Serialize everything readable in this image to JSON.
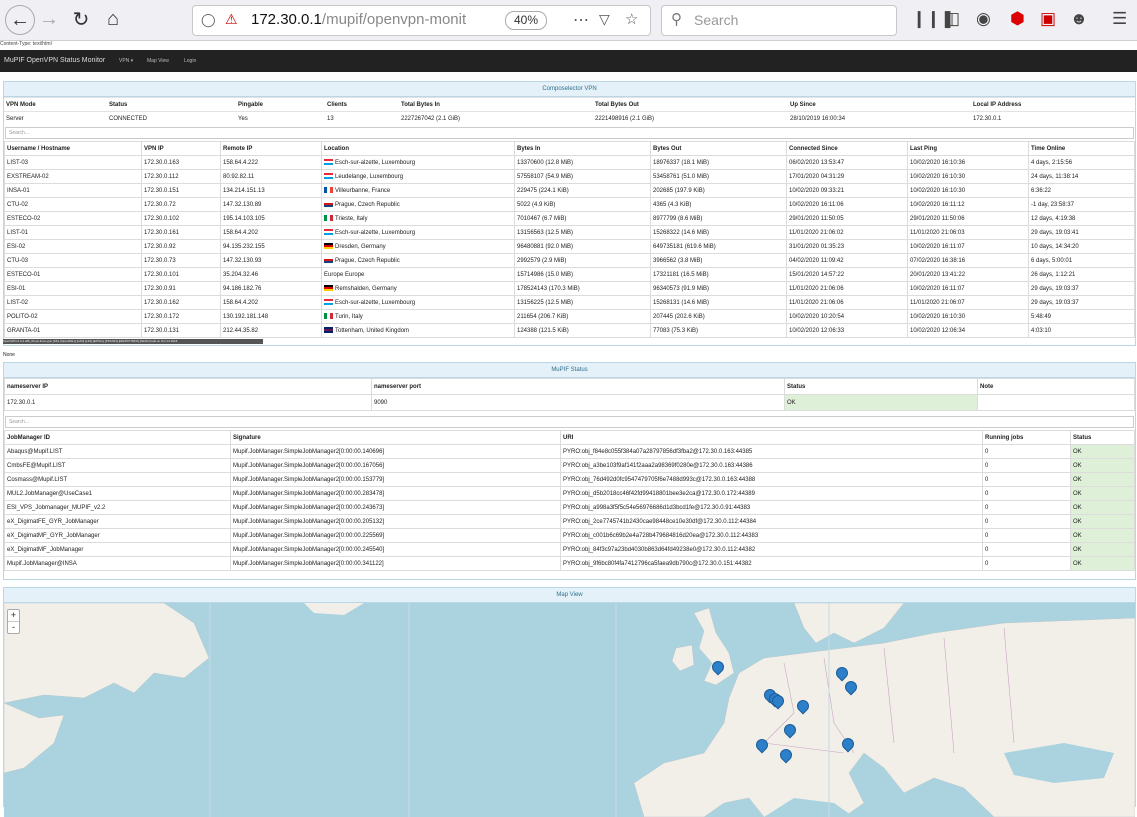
{
  "browser": {
    "url_host": "172.30.0.1",
    "url_path": "/mupif/openvpn-monit",
    "zoom": "40%",
    "search_placeholder": "Search",
    "content_type_line": "Content-Type: text/html"
  },
  "navbar": {
    "brand": "MuPIF OpenVPN Status Monitor",
    "links": [
      "VPN ▾",
      "Map View",
      "Login"
    ]
  },
  "vpn": {
    "title": "Composelector VPN",
    "summary_headers": [
      "VPN Mode",
      "Status",
      "Pingable",
      "Clients",
      "Total Bytes In",
      "Total Bytes Out",
      "Up Since",
      "Local IP Address"
    ],
    "summary_row": [
      "Server",
      "CONNECTED",
      "Yes",
      "13",
      "2227267042 (2.1 GiB)",
      "2221498916 (2.1 GiB)",
      "28/10/2019 16:00:34",
      "172.30.0.1"
    ],
    "search_placeholder": "Search...",
    "client_headers": [
      "Username / Hostname",
      "VPN IP",
      "Remote IP",
      "Location",
      "Bytes In",
      "Bytes Out",
      "Connected Since",
      "Last Ping",
      "Time Online"
    ],
    "clients": [
      {
        "name": "LIST-03",
        "vpn_ip": "172.30.0.163",
        "remote_ip": "158.64.4.222",
        "flag": "lu",
        "location": "Esch-sur-alzette, Luxembourg",
        "bytes_in": "13370600 (12.8 MiB)",
        "bytes_out": "18976337 (18.1 MiB)",
        "connected": "06/02/2020 13:53:47",
        "last_ping": "10/02/2020 16:10:36",
        "online": "4 days, 2:15:56"
      },
      {
        "name": "EXSTREAM-02",
        "vpn_ip": "172.30.0.112",
        "remote_ip": "80.92.82.11",
        "flag": "lu",
        "location": "Leudelange, Luxembourg",
        "bytes_in": "57558107 (54.9 MiB)",
        "bytes_out": "53458761 (51.0 MiB)",
        "connected": "17/01/2020 04:31:29",
        "last_ping": "10/02/2020 16:10:30",
        "online": "24 days, 11:38:14"
      },
      {
        "name": "INSA-01",
        "vpn_ip": "172.30.0.151",
        "remote_ip": "134.214.151.13",
        "flag": "fr",
        "location": "Villeurbanne, France",
        "bytes_in": "229475 (224.1 KiB)",
        "bytes_out": "202685 (197.9 KiB)",
        "connected": "10/02/2020 09:33:21",
        "last_ping": "10/02/2020 16:10:30",
        "online": "6:36:22"
      },
      {
        "name": "CTU-02",
        "vpn_ip": "172.30.0.72",
        "remote_ip": "147.32.130.89",
        "flag": "cz",
        "location": "Prague, Czech Republic",
        "bytes_in": "5022 (4.9 KiB)",
        "bytes_out": "4365 (4.3 KiB)",
        "connected": "10/02/2020 16:11:06",
        "last_ping": "10/02/2020 16:11:12",
        "online": "-1 day, 23:58:37"
      },
      {
        "name": "ESTECO-02",
        "vpn_ip": "172.30.0.102",
        "remote_ip": "195.14.103.105",
        "flag": "it",
        "location": "Trieste, Italy",
        "bytes_in": "7010467 (6.7 MiB)",
        "bytes_out": "8977799 (8.6 MiB)",
        "connected": "29/01/2020 11:50:05",
        "last_ping": "29/01/2020 11:50:06",
        "online": "12 days, 4:19:38"
      },
      {
        "name": "LIST-01",
        "vpn_ip": "172.30.0.161",
        "remote_ip": "158.64.4.202",
        "flag": "lu",
        "location": "Esch-sur-alzette, Luxembourg",
        "bytes_in": "13156563 (12.5 MiB)",
        "bytes_out": "15268322 (14.6 MiB)",
        "connected": "11/01/2020 21:06:02",
        "last_ping": "11/01/2020 21:06:03",
        "online": "29 days, 19:03:41"
      },
      {
        "name": "ESI-02",
        "vpn_ip": "172.30.0.92",
        "remote_ip": "94.135.232.155",
        "flag": "de",
        "location": "Dresden, Germany",
        "bytes_in": "96480881 (92.0 MiB)",
        "bytes_out": "649735181 (619.6 MiB)",
        "connected": "31/01/2020 01:35:23",
        "last_ping": "10/02/2020 16:11:07",
        "online": "10 days, 14:34:20"
      },
      {
        "name": "CTU-03",
        "vpn_ip": "172.30.0.73",
        "remote_ip": "147.32.130.93",
        "flag": "cz",
        "location": "Prague, Czech Republic",
        "bytes_in": "2992579 (2.9 MiB)",
        "bytes_out": "3966562 (3.8 MiB)",
        "connected": "04/02/2020 11:09:42",
        "last_ping": "07/02/2020 16:38:16",
        "online": "6 days, 5:00:01"
      },
      {
        "name": "ESTECO-01",
        "vpn_ip": "172.30.0.101",
        "remote_ip": "35.204.32.46",
        "flag": "",
        "location": "Europe Europe",
        "bytes_in": "15714986 (15.0 MiB)",
        "bytes_out": "17321181 (16.5 MiB)",
        "connected": "15/01/2020 14:57:22",
        "last_ping": "20/01/2020 13:41:22",
        "online": "26 days, 1:12:21"
      },
      {
        "name": "ESI-01",
        "vpn_ip": "172.30.0.91",
        "remote_ip": "94.186.182.76",
        "flag": "de",
        "location": "Remshalden, Germany",
        "bytes_in": "178524143 (170.3 MiB)",
        "bytes_out": "96340573 (91.9 MiB)",
        "connected": "11/01/2020 21:06:06",
        "last_ping": "10/02/2020 16:11:07",
        "online": "29 days, 19:03:37"
      },
      {
        "name": "LIST-02",
        "vpn_ip": "172.30.0.162",
        "remote_ip": "158.64.4.202",
        "flag": "lu",
        "location": "Esch-sur-alzette, Luxembourg",
        "bytes_in": "13156225 (12.5 MiB)",
        "bytes_out": "15268131 (14.6 MiB)",
        "connected": "11/01/2020 21:06:06",
        "last_ping": "11/01/2020 21:06:07",
        "online": "29 days, 19:03:37"
      },
      {
        "name": "POLITO-02",
        "vpn_ip": "172.30.0.172",
        "remote_ip": "130.192.181.148",
        "flag": "it",
        "location": "Turin, Italy",
        "bytes_in": "211654 (206.7 KiB)",
        "bytes_out": "207445 (202.6 KiB)",
        "connected": "10/02/2020 10:20:54",
        "last_ping": "10/02/2020 16:10:30",
        "online": "5:48:49"
      },
      {
        "name": "GRANTA-01",
        "vpn_ip": "172.30.0.131",
        "remote_ip": "212.44.35.82",
        "flag": "gb",
        "location": "Tottenham, United Kingdom",
        "bytes_in": "124388 (121.5 KiB)",
        "bytes_out": "77083 (75.3 KiB)",
        "connected": "10/02/2020 12:06:33",
        "last_ping": "10/02/2020 12:06:34",
        "online": "4:03:10"
      }
    ],
    "openvpn_version": "OpenVPN 2.4.4 x86_64-pc-linux-gnu [SSL (OpenSSL)] [LZO] [LZ4] [EPOLL] [PKCS11] [MH/PKTINFO] [AEAD] built on Oct 14 2018",
    "none_text": "None"
  },
  "mupif": {
    "title": "MuPIF Status",
    "ns_headers": [
      "nameserver IP",
      "nameserver port",
      "Status",
      "Note"
    ],
    "ns_row": [
      "172.30.0.1",
      "9090",
      "OK",
      ""
    ],
    "search_placeholder": "Search...",
    "job_headers": [
      "JobManager ID",
      "Signature",
      "URI",
      "Running jobs",
      "Status"
    ],
    "jobs": [
      {
        "id": "Abaqus@Mupif.LIST",
        "sig": "Mupif.JobManager.SimpleJobManager2[0:00:00.140696]",
        "uri": "PYRO:obj_f84e8c055f384a07a28797856df3fba2@172.30.0.163:44385",
        "running": "0",
        "status": "OK"
      },
      {
        "id": "CmbsFE@Mupif.LIST",
        "sig": "Mupif.JobManager.SimpleJobManager2[0:00:00.167056]",
        "uri": "PYRO:obj_a3be103f9af141f2aaa2a98369f0280e@172.30.0.163:44386",
        "running": "0",
        "status": "OK"
      },
      {
        "id": "Cosmass@Mupif.LIST",
        "sig": "Mupif.JobManager.SimpleJobManager2[0:00:00.153779]",
        "uri": "PYRO:obj_76d492d0fc9547479705f6e7488d993c@172.30.0.163:44388",
        "running": "0",
        "status": "OK"
      },
      {
        "id": "MUL2.JobManager@UseCase1",
        "sig": "Mupif.JobManager.SimpleJobManager2[0:00:00.283478]",
        "uri": "PYRO:obj_d5b2018cc46f42fd99418801bee3e2ca@172.30.0.172:44389",
        "running": "0",
        "status": "OK"
      },
      {
        "id": "ESI_VPS_Jobmanager_MUPIF_v2.2",
        "sig": "Mupif.JobManager.SimpleJobManager2[0:00:00.243673]",
        "uri": "PYRO:obj_a998a3f5f5c54e56976686d1d3bcd1fe@172.30.0.91:44383",
        "running": "0",
        "status": "OK"
      },
      {
        "id": "eX_DigimatFE_GYR_JobManager",
        "sig": "Mupif.JobManager.SimpleJobManager2[0:00:00.205132]",
        "uri": "PYRO:obj_2ce7745741b2430cae98448ce10e30df@172.30.0.112:44384",
        "running": "0",
        "status": "OK"
      },
      {
        "id": "eX_DigimatMF_GYR_JobManager",
        "sig": "Mupif.JobManager.SimpleJobManager2[0:00:00.225569]",
        "uri": "PYRO:obj_c001b6c69b2e4a728b479684816d20ea@172.30.0.112:44383",
        "running": "0",
        "status": "OK"
      },
      {
        "id": "eX_DigimatMF_JobManager",
        "sig": "Mupif.JobManager.SimpleJobManager2[0:00:00.245540]",
        "uri": "PYRO:obj_84f3c97a23bd4030b863d64fd49238e0@172.30.0.112:44382",
        "running": "0",
        "status": "OK"
      },
      {
        "id": "Mupif.JobManager@INSA",
        "sig": "Mupif.JobManager.SimpleJobManager2[0:00:00.341122]",
        "uri": "PYRO:obj_9f6bc80f4fa7412796ca5faea9db790c@172.30.0.151:44382",
        "running": "0",
        "status": "OK"
      }
    ]
  },
  "map": {
    "title": "Map View",
    "zoom_in": "+",
    "zoom_out": "-",
    "marker_count": 11
  },
  "colors": {
    "panel_head": "#e4f1f8",
    "ok": "#dff0d8",
    "navbar": "#222222",
    "marker": "#2c7fc9"
  }
}
